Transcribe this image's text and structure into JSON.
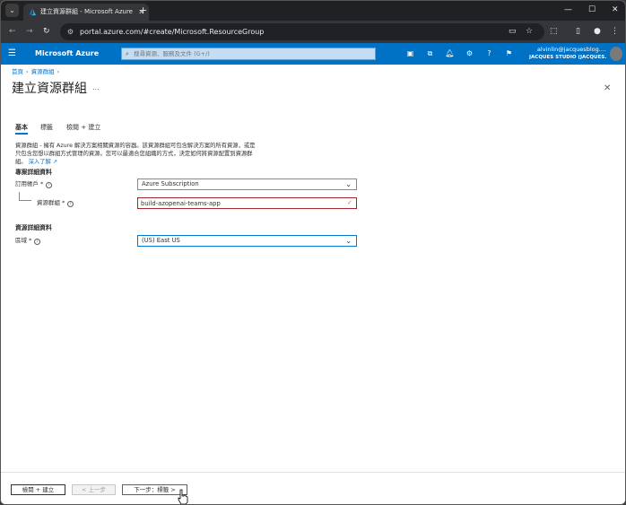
{
  "browser": {
    "tab_title": "建立資源群組 - Microsoft Azure",
    "url": "portal.azure.com/#create/Microsoft.ResourceGroup",
    "tab_dropdown_icon": "chevron-down-icon",
    "new_tab": "+"
  },
  "azure_header": {
    "brand": "Microsoft Azure",
    "search_placeholder": "搜尋資源、服務及文件 (G+/)",
    "user_name": "alvinlin@jacquesblog....",
    "user_directory": "JACQUES STUDIO (JACQUES..."
  },
  "breadcrumb": {
    "items": [
      "首頁",
      "資源群組"
    ]
  },
  "page": {
    "title": "建立資源群組",
    "more": "...",
    "close": "✕"
  },
  "tabs": [
    {
      "label": "基本",
      "active": true
    },
    {
      "label": "標籤",
      "active": false
    },
    {
      "label": "檢閱 + 建立",
      "active": false
    }
  ],
  "description": {
    "text": "資源群組 - 擁有 Azure 解決方案相關資源的容器。該資源群組可包含解決方案的所有資源，或是只包含您想以群組方式管理的資源。您可以最適合您組織的方式，決定如何將資源配置到資源群組。",
    "link": "深入了解 ↗"
  },
  "project_details": {
    "heading": "專案詳細資料",
    "subscription_label": "訂用帳戶 *",
    "subscription_value": "Azure Subscription",
    "resource_group_label": "資源群組 *",
    "resource_group_value": "build-azopenai-teams-app"
  },
  "resource_details": {
    "heading": "資源詳細資料",
    "region_label": "區域 *",
    "region_value": "(US) East US"
  },
  "footer": {
    "review_create": "檢閱 + 建立",
    "previous": "< 上一步",
    "next": "下一步：標籤 >"
  }
}
